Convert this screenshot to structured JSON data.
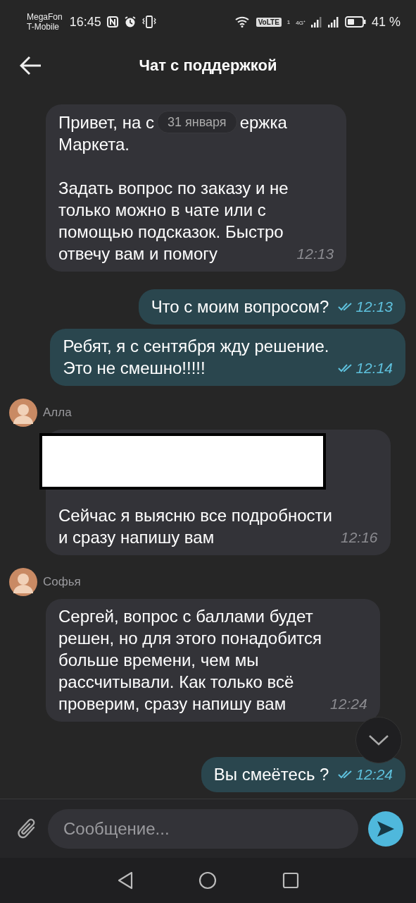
{
  "status_bar": {
    "carriers": [
      "MegaFon",
      "T-Mobile"
    ],
    "time": "16:45",
    "volte": "VoLTE",
    "sim": "1",
    "network": "4G⁺",
    "battery": "41 %"
  },
  "header": {
    "title": "Чат с поддержкой"
  },
  "date_label": "31 января",
  "messages": [
    {
      "kind": "incoming",
      "first_line_parts": [
        "Привет, на с",
        "ержка"
      ],
      "text": "Маркета.\n\nЗадать вопрос по заказу и не\nтолько можно в чате или с\nпомощью подсказок. Быстро\nотвечу вам и помогу",
      "time": "12:13"
    },
    {
      "kind": "outgoing",
      "text": "Что с моим вопросом?",
      "time": "12:13",
      "read": true
    },
    {
      "kind": "outgoing",
      "text": "Ребят, я с сентября жду решение.\nЭто не смешно!!!!!",
      "time": "12:14",
      "read": true
    },
    {
      "kind": "incoming",
      "sender": "Алла",
      "redacted": true,
      "text": "Сейчас я выясню все подробности\nи сразу напишу вам",
      "time": "12:16"
    },
    {
      "kind": "incoming",
      "sender": "Софья",
      "text": "Сергей, вопрос с баллами будет\nрешен, но для этого понадобится\nбольше времени, чем мы\nрассчитывали. Как только всё\nпроверим, сразу напишу вам",
      "time": "12:24"
    },
    {
      "kind": "outgoing",
      "text": "Вы смеётесь ?",
      "time": "12:24",
      "read": true
    }
  ],
  "composer": {
    "placeholder": "Сообщение..."
  }
}
